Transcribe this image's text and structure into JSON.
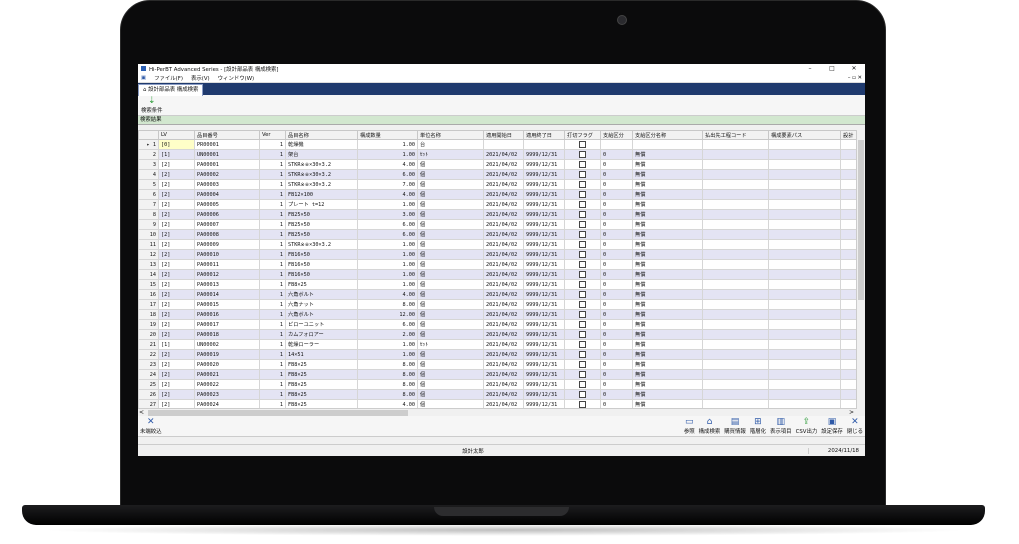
{
  "window": {
    "title": "Hi-PerBT Advanced Series - [設計部品表 構成検索]",
    "minimize": "–",
    "maximize": "□",
    "close": "✕"
  },
  "menu": {
    "items": [
      "ファイル(F)",
      "表示(V)",
      "ウィンドウ(W)"
    ],
    "right": "– ▫ ✕"
  },
  "tab": {
    "label": "設計部品表 構成検索"
  },
  "toolbar": {
    "search_conditions": "検索条件"
  },
  "section": {
    "results": "検索結果"
  },
  "columns": [
    "",
    "LV",
    "品目番号",
    "Ver",
    "品目名称",
    "構成数量",
    "単位名称",
    "適用開始日",
    "適用終了日",
    "打切フラグ",
    "支給区分",
    "支給区分名称",
    "払出先工程コード",
    "構成要素パス",
    "設計"
  ],
  "rows": [
    {
      "n": "1",
      "lv": "[0]",
      "code": "PR00001",
      "ver": "1",
      "name": "乾燥機",
      "qty": "1.00",
      "unit": "台",
      "start": "",
      "end": "",
      "kbn": "",
      "kbn_name": ""
    },
    {
      "n": "2",
      "lv": "[1]",
      "code": "UN00001",
      "ver": "1",
      "name": "架台",
      "qty": "1.00",
      "unit": "ｾｯﾄ",
      "start": "2021/04/02",
      "end": "9999/12/31",
      "kbn": "0",
      "kbn_name": "無償"
    },
    {
      "n": "3",
      "lv": "[2]",
      "code": "PA00001",
      "ver": "1",
      "name": "STKR※※×30×3.2",
      "qty": "4.00",
      "unit": "個",
      "start": "2021/04/02",
      "end": "9999/12/31",
      "kbn": "0",
      "kbn_name": "無償"
    },
    {
      "n": "4",
      "lv": "[2]",
      "code": "PA00002",
      "ver": "1",
      "name": "STKR※※×30×3.2",
      "qty": "6.00",
      "unit": "個",
      "start": "2021/04/02",
      "end": "9999/12/31",
      "kbn": "0",
      "kbn_name": "無償"
    },
    {
      "n": "5",
      "lv": "[2]",
      "code": "PA00003",
      "ver": "1",
      "name": "STKR※※×30×3.2",
      "qty": "7.00",
      "unit": "個",
      "start": "2021/04/02",
      "end": "9999/12/31",
      "kbn": "0",
      "kbn_name": "無償"
    },
    {
      "n": "6",
      "lv": "[2]",
      "code": "PA00004",
      "ver": "1",
      "name": "FB12×100",
      "qty": "4.00",
      "unit": "個",
      "start": "2021/04/02",
      "end": "9999/12/31",
      "kbn": "0",
      "kbn_name": "無償"
    },
    {
      "n": "7",
      "lv": "[2]",
      "code": "PA00005",
      "ver": "1",
      "name": "プレート t=12",
      "qty": "1.00",
      "unit": "個",
      "start": "2021/04/02",
      "end": "9999/12/31",
      "kbn": "0",
      "kbn_name": "無償"
    },
    {
      "n": "8",
      "lv": "[2]",
      "code": "PA00006",
      "ver": "1",
      "name": "FB25×50",
      "qty": "3.00",
      "unit": "個",
      "start": "2021/04/02",
      "end": "9999/12/31",
      "kbn": "0",
      "kbn_name": "無償"
    },
    {
      "n": "9",
      "lv": "[2]",
      "code": "PA00007",
      "ver": "1",
      "name": "FB25×50",
      "qty": "6.00",
      "unit": "個",
      "start": "2021/04/02",
      "end": "9999/12/31",
      "kbn": "0",
      "kbn_name": "無償"
    },
    {
      "n": "10",
      "lv": "[2]",
      "code": "PA00008",
      "ver": "1",
      "name": "FB25×50",
      "qty": "6.00",
      "unit": "個",
      "start": "2021/04/02",
      "end": "9999/12/31",
      "kbn": "0",
      "kbn_name": "無償"
    },
    {
      "n": "11",
      "lv": "[2]",
      "code": "PA00009",
      "ver": "1",
      "name": "STKR※※×30×3.2",
      "qty": "1.00",
      "unit": "個",
      "start": "2021/04/02",
      "end": "9999/12/31",
      "kbn": "0",
      "kbn_name": "無償"
    },
    {
      "n": "12",
      "lv": "[2]",
      "code": "PA00010",
      "ver": "1",
      "name": "FB16×50",
      "qty": "1.00",
      "unit": "個",
      "start": "2021/04/02",
      "end": "9999/12/31",
      "kbn": "0",
      "kbn_name": "無償"
    },
    {
      "n": "13",
      "lv": "[2]",
      "code": "PA00011",
      "ver": "1",
      "name": "FB16×50",
      "qty": "1.00",
      "unit": "個",
      "start": "2021/04/02",
      "end": "9999/12/31",
      "kbn": "0",
      "kbn_name": "無償"
    },
    {
      "n": "14",
      "lv": "[2]",
      "code": "PA00012",
      "ver": "1",
      "name": "FB16×50",
      "qty": "1.00",
      "unit": "個",
      "start": "2021/04/02",
      "end": "9999/12/31",
      "kbn": "0",
      "kbn_name": "無償"
    },
    {
      "n": "15",
      "lv": "[2]",
      "code": "PA00013",
      "ver": "1",
      "name": "FB8×25",
      "qty": "1.00",
      "unit": "個",
      "start": "2021/04/02",
      "end": "9999/12/31",
      "kbn": "0",
      "kbn_name": "無償"
    },
    {
      "n": "16",
      "lv": "[2]",
      "code": "PA00014",
      "ver": "1",
      "name": "六角ボルト",
      "qty": "4.00",
      "unit": "個",
      "start": "2021/04/02",
      "end": "9999/12/31",
      "kbn": "0",
      "kbn_name": "無償"
    },
    {
      "n": "17",
      "lv": "[2]",
      "code": "PA00015",
      "ver": "1",
      "name": "六角ナット",
      "qty": "8.00",
      "unit": "個",
      "start": "2021/04/02",
      "end": "9999/12/31",
      "kbn": "0",
      "kbn_name": "無償"
    },
    {
      "n": "18",
      "lv": "[2]",
      "code": "PA00016",
      "ver": "1",
      "name": "六角ボルト",
      "qty": "12.00",
      "unit": "個",
      "start": "2021/04/02",
      "end": "9999/12/31",
      "kbn": "0",
      "kbn_name": "無償"
    },
    {
      "n": "19",
      "lv": "[2]",
      "code": "PA00017",
      "ver": "1",
      "name": "ピローユニット",
      "qty": "6.00",
      "unit": "個",
      "start": "2021/04/02",
      "end": "9999/12/31",
      "kbn": "0",
      "kbn_name": "無償"
    },
    {
      "n": "20",
      "lv": "[2]",
      "code": "PA00018",
      "ver": "1",
      "name": "カムフォロアー",
      "qty": "2.00",
      "unit": "個",
      "start": "2021/04/02",
      "end": "9999/12/31",
      "kbn": "0",
      "kbn_name": "無償"
    },
    {
      "n": "21",
      "lv": "[1]",
      "code": "UN00002",
      "ver": "1",
      "name": "乾燥ローラー",
      "qty": "1.00",
      "unit": "ｾｯﾄ",
      "start": "2021/04/02",
      "end": "9999/12/31",
      "kbn": "0",
      "kbn_name": "無償"
    },
    {
      "n": "22",
      "lv": "[2]",
      "code": "PA00019",
      "ver": "1",
      "name": "14×51",
      "qty": "1.00",
      "unit": "個",
      "start": "2021/04/02",
      "end": "9999/12/31",
      "kbn": "0",
      "kbn_name": "無償"
    },
    {
      "n": "23",
      "lv": "[2]",
      "code": "PA00020",
      "ver": "1",
      "name": "FB8×25",
      "qty": "8.00",
      "unit": "個",
      "start": "2021/04/02",
      "end": "9999/12/31",
      "kbn": "0",
      "kbn_name": "無償"
    },
    {
      "n": "24",
      "lv": "[2]",
      "code": "PA00021",
      "ver": "1",
      "name": "FB8×25",
      "qty": "8.00",
      "unit": "個",
      "start": "2021/04/02",
      "end": "9999/12/31",
      "kbn": "0",
      "kbn_name": "無償"
    },
    {
      "n": "25",
      "lv": "[2]",
      "code": "PA00022",
      "ver": "1",
      "name": "FB8×25",
      "qty": "8.00",
      "unit": "個",
      "start": "2021/04/02",
      "end": "9999/12/31",
      "kbn": "0",
      "kbn_name": "無償"
    },
    {
      "n": "26",
      "lv": "[2]",
      "code": "PA00023",
      "ver": "1",
      "name": "FB8×25",
      "qty": "8.00",
      "unit": "個",
      "start": "2021/04/02",
      "end": "9999/12/31",
      "kbn": "0",
      "kbn_name": "無償"
    },
    {
      "n": "27",
      "lv": "[2]",
      "code": "PA00024",
      "ver": "1",
      "name": "FB8×25",
      "qty": "4.00",
      "unit": "個",
      "start": "2021/04/02",
      "end": "9999/12/31",
      "kbn": "0",
      "kbn_name": "無償"
    }
  ],
  "scroll": {
    "left": "<",
    "right": ">"
  },
  "bottom_toolbar": {
    "clear_filter": "未端絞込",
    "buttons": [
      "参照",
      "構成検索",
      "購買情報",
      "階層化",
      "表示項目",
      "CSV出力",
      "設定保存",
      "閉じる"
    ]
  },
  "status": {
    "user": "設計太郎",
    "date": "2024/11/18"
  }
}
